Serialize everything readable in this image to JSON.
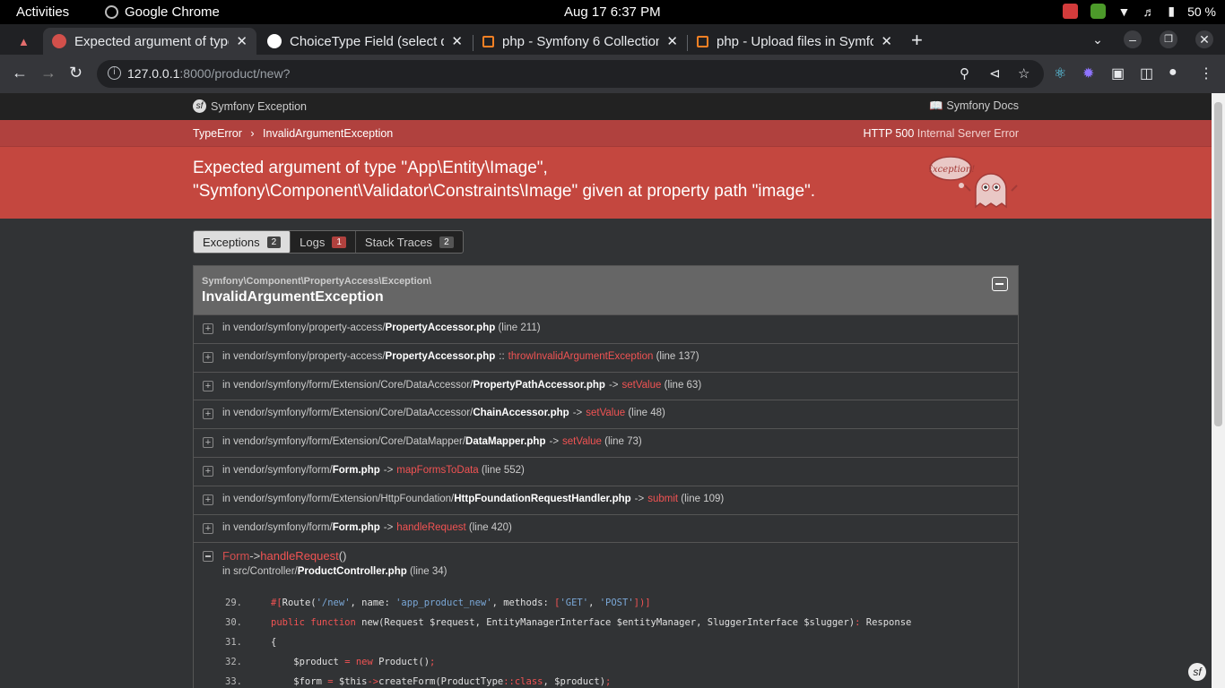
{
  "system_bar": {
    "activities": "Activities",
    "app_name": "Google Chrome",
    "clock": "Aug 17   6:37 PM",
    "battery": "50 %"
  },
  "browser": {
    "tabs": [
      {
        "title": "Expected argument of type",
        "active": true,
        "favicon_color": "#d2504b"
      },
      {
        "title": "ChoiceType Field (select d",
        "active": false,
        "favicon_color": "#ffffff"
      },
      {
        "title": "php - Symfony 6 Collection",
        "active": false,
        "favicon_color": "#f48024"
      },
      {
        "title": "php - Upload files in Symfo",
        "active": false,
        "favicon_color": "#f48024"
      }
    ],
    "url_host": "127.0.0.1",
    "url_rest": ":8000/product/new?"
  },
  "symfony": {
    "brand": "Symfony Exception",
    "docs": "Symfony Docs",
    "crumb_1": "TypeError",
    "crumb_2": "InvalidArgumentException",
    "http_code": "HTTP 500",
    "http_text": "Internal Server Error",
    "message_line1": "Expected argument of type \"App\\Entity\\Image\",",
    "message_line2": "\"Symfony\\Component\\Validator\\Constraints\\Image\" given at property path \"image\".",
    "ghost_label": "Exception!",
    "tabs": [
      {
        "label": "Exceptions",
        "count": "2"
      },
      {
        "label": "Logs",
        "count": "1"
      },
      {
        "label": "Stack Traces",
        "count": "2"
      }
    ],
    "exception_ns": "Symfony\\Component\\PropertyAccess\\Exception\\",
    "exception_class": "InvalidArgumentException",
    "traces": [
      {
        "path": "in vendor/symfony/property-access/",
        "file": "PropertyAccessor.php",
        "op": "",
        "fn": "",
        "line": "(line 211)"
      },
      {
        "path": "in vendor/symfony/property-access/",
        "file": "PropertyAccessor.php",
        "op": "::",
        "fn": "throwInvalidArgumentException",
        "line": "(line 137)"
      },
      {
        "path": "in vendor/symfony/form/Extension/Core/DataAccessor/",
        "file": "PropertyPathAccessor.php",
        "op": "->",
        "fn": "setValue",
        "line": "(line 63)"
      },
      {
        "path": "in vendor/symfony/form/Extension/Core/DataAccessor/",
        "file": "ChainAccessor.php",
        "op": "->",
        "fn": "setValue",
        "line": "(line 48)"
      },
      {
        "path": "in vendor/symfony/form/Extension/Core/DataMapper/",
        "file": "DataMapper.php",
        "op": "->",
        "fn": "setValue",
        "line": "(line 73)"
      },
      {
        "path": "in vendor/symfony/form/",
        "file": "Form.php",
        "op": "->",
        "fn": "mapFormsToData",
        "line": "(line 552)"
      },
      {
        "path": "in vendor/symfony/form/Extension/HttpFoundation/",
        "file": "HttpFoundationRequestHandler.php",
        "op": "->",
        "fn": "submit",
        "line": "(line 109)"
      },
      {
        "path": "in vendor/symfony/form/",
        "file": "Form.php",
        "op": "->",
        "fn": "handleRequest",
        "line": "(line 420)"
      }
    ],
    "open_trace": {
      "class": "Form",
      "op": "->",
      "fn": "handleRequest",
      "paren": "()",
      "path": "in src/Controller/",
      "file": "ProductController.php",
      "line": "(line 34)"
    },
    "code_lines": [
      {
        "n": "29."
      },
      {
        "n": "30."
      },
      {
        "n": "31."
      },
      {
        "n": "32."
      },
      {
        "n": "33."
      }
    ]
  }
}
